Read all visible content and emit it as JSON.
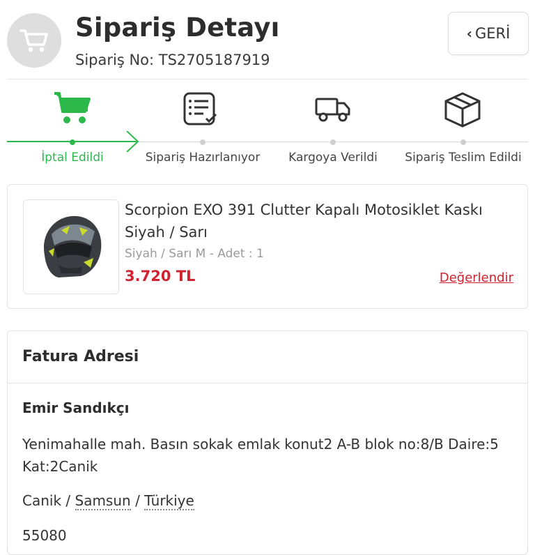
{
  "header": {
    "title": "Sipariş Detayı",
    "order_no": "Sipariş No: TS2705187919",
    "back_label": "GERİ",
    "back_chevron": "‹"
  },
  "steps": [
    {
      "label": "İptal Edildi",
      "icon": "cart-icon",
      "active": true
    },
    {
      "label": "Sipariş Hazırlanıyor",
      "icon": "checklist-icon",
      "active": false
    },
    {
      "label": "Kargoya Verildi",
      "icon": "truck-icon",
      "active": false
    },
    {
      "label": "Sipariş Teslim Edildi",
      "icon": "box-icon",
      "active": false
    }
  ],
  "product": {
    "name": "Scorpion EXO 391 Clutter Kapalı Motosiklet Kaskı Siyah / Sarı",
    "variant": "Siyah / Sarı M - Adet : 1",
    "price": "3.720 TL",
    "rate_label": "Değerlendir"
  },
  "address": {
    "title": "Fatura Adresi",
    "name": "Emir Sandıkçı",
    "line": "Yenimahalle mah. Basın sokak emlak konut2 A-B blok no:8/B Daire:5 Kat:2Canik",
    "district": "Canik",
    "city": "Samsun",
    "country": "Türkiye",
    "sep": " / ",
    "postal": "55080"
  },
  "colors": {
    "accent_green": "#2db84c",
    "price_red": "#cf2330",
    "avatar_gray": "#dedede"
  }
}
